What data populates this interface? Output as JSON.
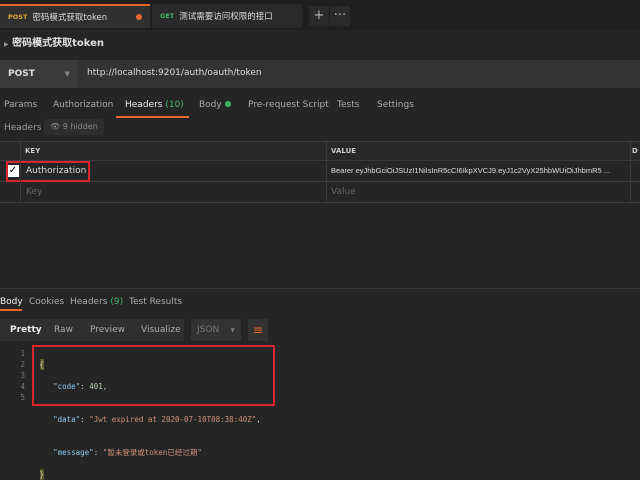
{
  "tabs": [
    {
      "method": "POST",
      "label": "密码模式获取token",
      "active": true
    },
    {
      "method": "GET",
      "label": "测试需要访问权限的接口",
      "active": false
    }
  ],
  "title": "密码模式获取token",
  "request": {
    "method": "POST",
    "url": "http://localhost:9201/auth/oauth/token"
  },
  "req_tabs": {
    "params": "Params",
    "authorization": "Authorization",
    "headers": "Headers",
    "headers_count": "(10)",
    "body": "Body",
    "prerequest": "Pre-request Script",
    "tests": "Tests",
    "settings": "Settings"
  },
  "headers_section": {
    "label": "Headers",
    "hidden": "9 hidden"
  },
  "table": {
    "key_header": "KEY",
    "value_header": "VALUE",
    "desc_header": "D",
    "rows": [
      {
        "key": "Authorization",
        "value": "Bearer eyJhbGciOiJSUzI1NiIsInR5cCI6IkpXVCJ9.eyJ1c2VyX25hbWUiOiJhbmR5 ...",
        "checked": true
      }
    ],
    "key_placeholder": "Key",
    "value_placeholder": "Value"
  },
  "resp_tabs": {
    "body": "Body",
    "cookies": "Cookies",
    "headers": "Headers",
    "headers_count": "(9)",
    "test_results": "Test Results"
  },
  "resp_toolbar": {
    "pretty": "Pretty",
    "raw": "Raw",
    "preview": "Preview",
    "visualize": "Visualize",
    "format": "JSON"
  },
  "code": {
    "line_numbers": [
      "1",
      "2",
      "3",
      "4",
      "5"
    ],
    "open": "{",
    "close": "}",
    "k1": "\"code\"",
    "v1": "401",
    "k2": "\"data\"",
    "v2": "\"Jwt expired at 2020-07-10T08:38:40Z\"",
    "k3": "\"message\"",
    "v3": "\"暂未登录或token已经过期\""
  }
}
